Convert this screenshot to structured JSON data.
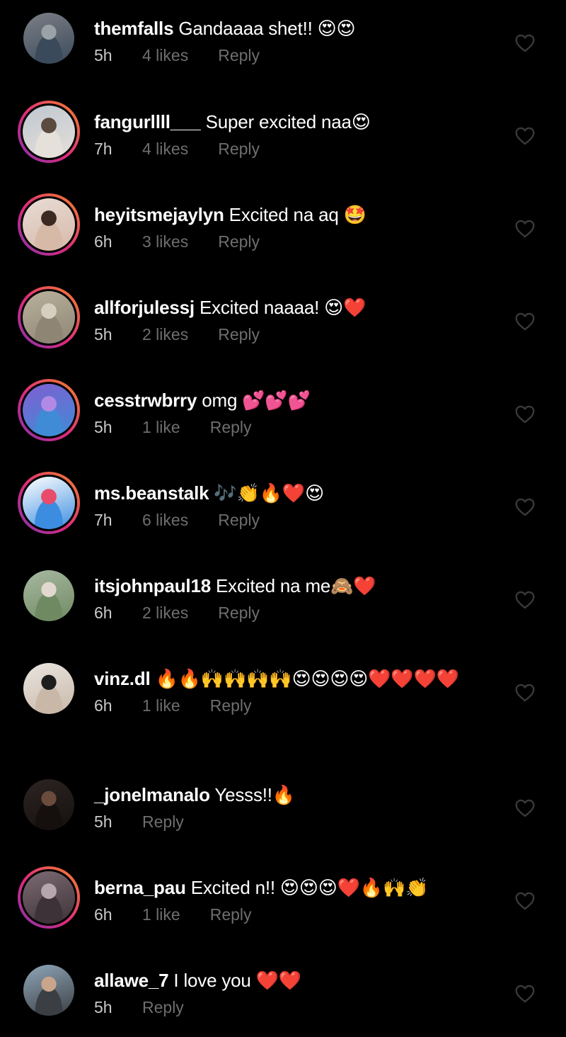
{
  "colors": {
    "background": "#000000",
    "username": "#ffffff",
    "meta_time": "#c9c9c9",
    "meta_secondary": "#6e6e6e",
    "heart_outline": "#3a3a3a",
    "story_ring": [
      "#f58529",
      "#dd2a7b",
      "#8134af"
    ]
  },
  "comments": [
    {
      "username": "themfalls",
      "text": "Gandaaaa shet!! 😍😍",
      "time": "5h",
      "likes": "4 likes",
      "reply": "Reply",
      "story_ring": false,
      "avatar_colors": [
        "#7c7f86",
        "#9aa3a8",
        "#3b4a5a"
      ]
    },
    {
      "username": "fangurllll___",
      "text": "Super excited naa😍",
      "time": "7h",
      "likes": "4 likes",
      "reply": "Reply",
      "story_ring": true,
      "avatar_colors": [
        "#bfc7d0",
        "#5b4a3e",
        "#e5e0da"
      ]
    },
    {
      "username": "heyitsmejaylyn",
      "text": "Excited na aq 🤩",
      "time": "6h",
      "likes": "3 likes",
      "reply": "Reply",
      "story_ring": true,
      "avatar_colors": [
        "#e8dcd5",
        "#3a2a22",
        "#d7b9a8"
      ]
    },
    {
      "username": "allforjulessj",
      "text": "Excited naaaa! 😍❤️",
      "time": "5h",
      "likes": "2 likes",
      "reply": "Reply",
      "story_ring": true,
      "avatar_colors": [
        "#b9b09c",
        "#d6cfbf",
        "#8f8575"
      ]
    },
    {
      "username": "cesstrwbrry",
      "text": "omg 💕💕💕",
      "time": "5h",
      "likes": "1 like",
      "reply": "Reply",
      "story_ring": true,
      "avatar_colors": [
        "#7f5fd1",
        "#b28ae6",
        "#3f8bd6"
      ]
    },
    {
      "username": "ms.beanstalk",
      "text": "🎶👏🔥❤️😍",
      "time": "7h",
      "likes": "6 likes",
      "reply": "Reply",
      "story_ring": true,
      "avatar_colors": [
        "#ffffff",
        "#e84c6a",
        "#3c8de0"
      ]
    },
    {
      "username": "itsjohnpaul18",
      "text": "Excited na me🙈❤️",
      "time": "6h",
      "likes": "2 likes",
      "reply": "Reply",
      "story_ring": false,
      "avatar_colors": [
        "#a8b8a0",
        "#e2d8cf",
        "#6f8a63"
      ]
    },
    {
      "username": "vinz.dl",
      "text": "🔥🔥🙌🙌🙌🙌😍😍😍😍❤️❤️❤️❤️",
      "time": "6h",
      "likes": "1 like",
      "reply": "Reply",
      "story_ring": false,
      "avatar_colors": [
        "#e9e5e0",
        "#1d1d1d",
        "#c9b8a8"
      ]
    },
    {
      "username": "_jonelmanalo",
      "text": "Yesss!!🔥",
      "time": "5h",
      "likes": "",
      "reply": "Reply",
      "story_ring": false,
      "avatar_colors": [
        "#2c2422",
        "#6b4b3c",
        "#15100e"
      ]
    },
    {
      "username": "berna_pau",
      "text": "Excited n!! 😍😍😍❤️🔥🙌👏",
      "time": "6h",
      "likes": "1 like",
      "reply": "Reply",
      "story_ring": true,
      "avatar_colors": [
        "#7c6a72",
        "#b7a6ab",
        "#3d3238"
      ]
    },
    {
      "username": "allawe_7",
      "text": "I love you ❤️❤️",
      "time": "5h",
      "likes": "",
      "reply": "Reply",
      "story_ring": false,
      "avatar_colors": [
        "#8fa6b8",
        "#c9a58c",
        "#3b3f44"
      ]
    }
  ]
}
